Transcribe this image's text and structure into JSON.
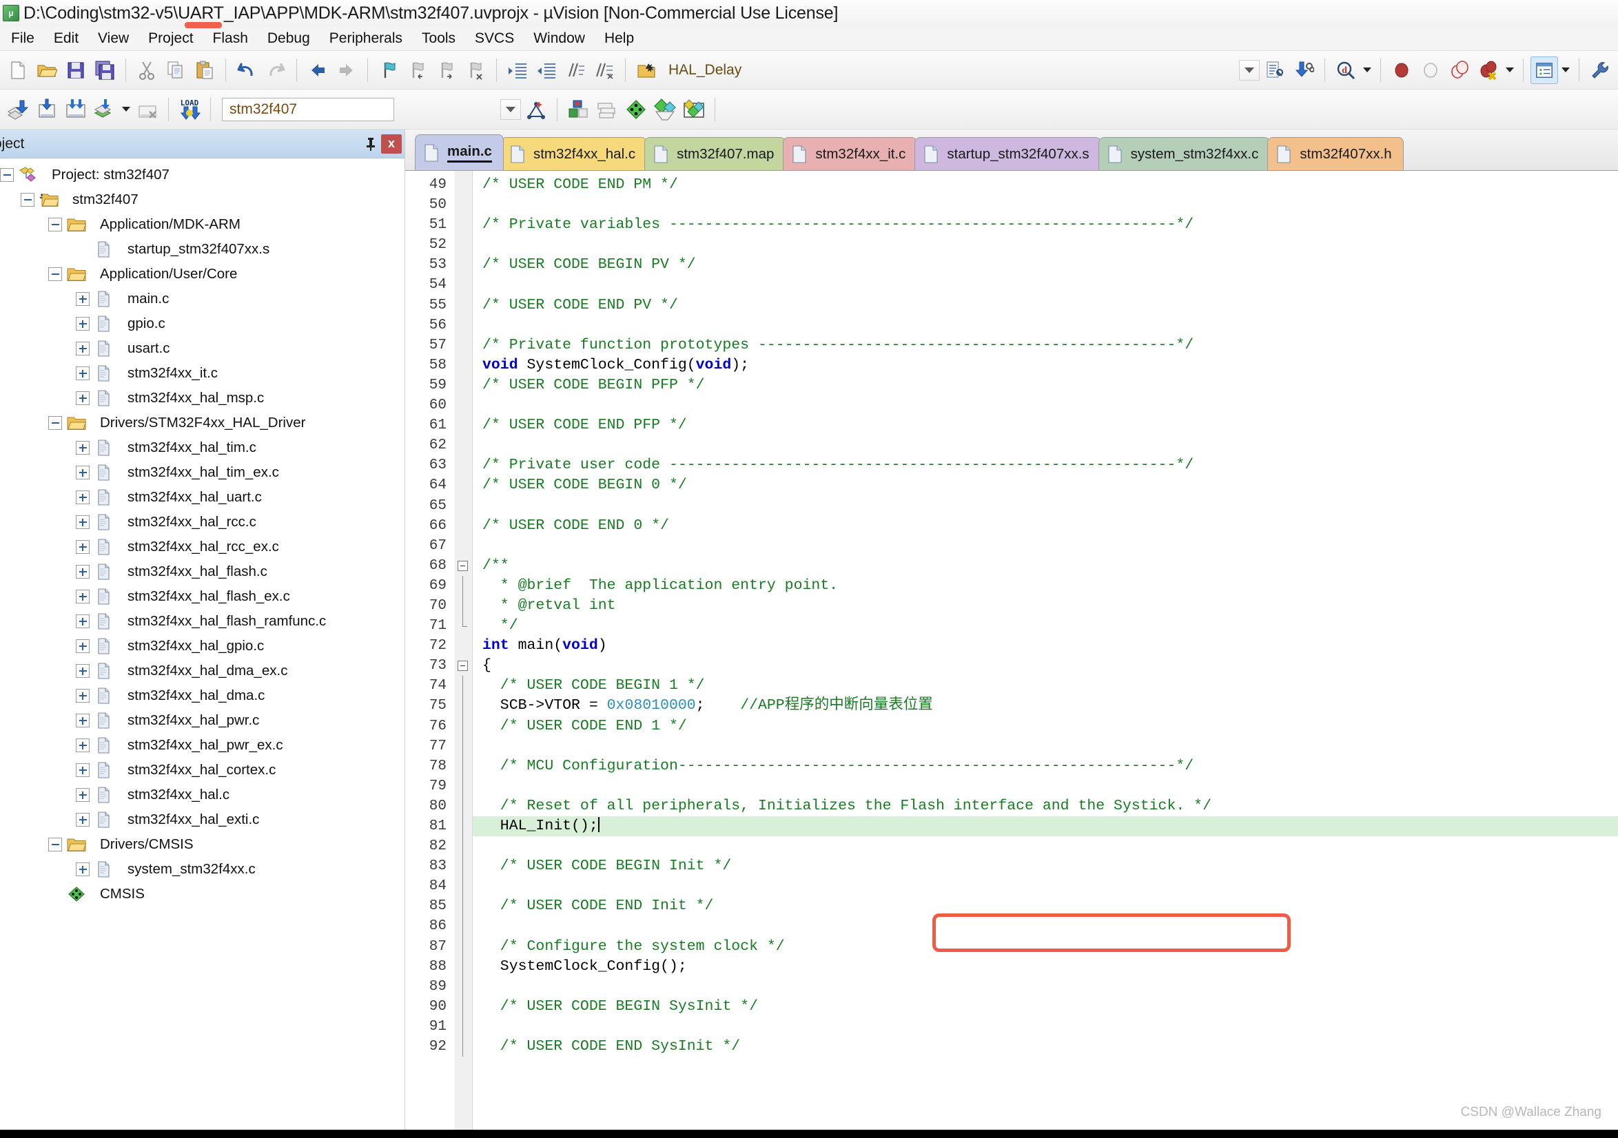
{
  "window": {
    "title": "D:\\Coding\\stm32-v5\\UART_IAP\\APP\\MDK-ARM\\stm32f407.uvprojx - µVision  [Non-Commercial Use License]",
    "app_icon": "uvision-icon",
    "annotation_color": "#ef5b46"
  },
  "menubar": {
    "items": [
      "File",
      "Edit",
      "View",
      "Project",
      "Flash",
      "Debug",
      "Peripherals",
      "Tools",
      "SVCS",
      "Window",
      "Help"
    ]
  },
  "toolbar_main": {
    "groups": [
      [
        "new-file-icon",
        "open-file-icon",
        "save-icon",
        "save-all-icon"
      ],
      [
        "cut-icon",
        "copy-icon",
        "paste-icon"
      ],
      [
        "undo-icon",
        "redo-icon"
      ],
      [
        "navigate-back-icon",
        "navigate-forward-icon"
      ],
      [
        "bookmark-toggle-icon",
        "bookmark-prev-icon",
        "bookmark-next-icon",
        "bookmark-clear-icon"
      ],
      [
        "indent-icon",
        "outdent-icon",
        "comment-icon",
        "uncomment-icon"
      ],
      [
        "find-in-files-icon"
      ]
    ],
    "function_box_value": "HAL_Delay",
    "right_groups": [
      [
        "dropdown-arrow-icon",
        "compile-file-icon",
        "download-icon"
      ],
      [
        "debug-session-icon"
      ],
      [
        "breakpoint-insert-icon",
        "breakpoint-disable-icon",
        "breakpoint-disable-all-icon",
        "breakpoint-kill-all-icon"
      ],
      [
        "project-window-icon"
      ],
      [
        "configure-icon"
      ]
    ]
  },
  "toolbar_build": {
    "buttons": [
      "translate-icon",
      "build-icon",
      "rebuild-icon",
      "batch-build-icon",
      "stop-build-icon",
      "download-load-icon"
    ],
    "target_value": "stm32f407",
    "right_buttons": [
      "options-target-icon",
      "manage-project-items-icon",
      "books-icon",
      "manage-runtime-env-icon",
      "pack-installer-icon",
      "select-software-packs-icon"
    ]
  },
  "project_panel": {
    "title": "roject",
    "pin_icon": "pin-icon",
    "close_icon": "close-icon",
    "tree": [
      {
        "label": "Project: stm32f407",
        "depth": 0,
        "icon": "project-icon",
        "expander": "minus"
      },
      {
        "label": "stm32f407",
        "depth": 1,
        "icon": "target-folder-icon",
        "expander": "minus"
      },
      {
        "label": "Application/MDK-ARM",
        "depth": 2,
        "icon": "folder-icon",
        "expander": "minus"
      },
      {
        "label": "startup_stm32f407xx.s",
        "depth": 3,
        "icon": "file-icon",
        "expander": "none"
      },
      {
        "label": "Application/User/Core",
        "depth": 2,
        "icon": "folder-icon",
        "expander": "minus"
      },
      {
        "label": "main.c",
        "depth": 3,
        "icon": "file-icon",
        "expander": "plus"
      },
      {
        "label": "gpio.c",
        "depth": 3,
        "icon": "file-icon",
        "expander": "plus"
      },
      {
        "label": "usart.c",
        "depth": 3,
        "icon": "file-icon",
        "expander": "plus"
      },
      {
        "label": "stm32f4xx_it.c",
        "depth": 3,
        "icon": "file-icon",
        "expander": "plus"
      },
      {
        "label": "stm32f4xx_hal_msp.c",
        "depth": 3,
        "icon": "file-icon",
        "expander": "plus"
      },
      {
        "label": "Drivers/STM32F4xx_HAL_Driver",
        "depth": 2,
        "icon": "folder-icon",
        "expander": "minus"
      },
      {
        "label": "stm32f4xx_hal_tim.c",
        "depth": 3,
        "icon": "file-icon",
        "expander": "plus"
      },
      {
        "label": "stm32f4xx_hal_tim_ex.c",
        "depth": 3,
        "icon": "file-icon",
        "expander": "plus"
      },
      {
        "label": "stm32f4xx_hal_uart.c",
        "depth": 3,
        "icon": "file-icon",
        "expander": "plus"
      },
      {
        "label": "stm32f4xx_hal_rcc.c",
        "depth": 3,
        "icon": "file-icon",
        "expander": "plus"
      },
      {
        "label": "stm32f4xx_hal_rcc_ex.c",
        "depth": 3,
        "icon": "file-icon",
        "expander": "plus"
      },
      {
        "label": "stm32f4xx_hal_flash.c",
        "depth": 3,
        "icon": "file-icon",
        "expander": "plus"
      },
      {
        "label": "stm32f4xx_hal_flash_ex.c",
        "depth": 3,
        "icon": "file-icon",
        "expander": "plus"
      },
      {
        "label": "stm32f4xx_hal_flash_ramfunc.c",
        "depth": 3,
        "icon": "file-icon",
        "expander": "plus"
      },
      {
        "label": "stm32f4xx_hal_gpio.c",
        "depth": 3,
        "icon": "file-icon",
        "expander": "plus"
      },
      {
        "label": "stm32f4xx_hal_dma_ex.c",
        "depth": 3,
        "icon": "file-icon",
        "expander": "plus"
      },
      {
        "label": "stm32f4xx_hal_dma.c",
        "depth": 3,
        "icon": "file-icon",
        "expander": "plus"
      },
      {
        "label": "stm32f4xx_hal_pwr.c",
        "depth": 3,
        "icon": "file-icon",
        "expander": "plus"
      },
      {
        "label": "stm32f4xx_hal_pwr_ex.c",
        "depth": 3,
        "icon": "file-icon",
        "expander": "plus"
      },
      {
        "label": "stm32f4xx_hal_cortex.c",
        "depth": 3,
        "icon": "file-icon",
        "expander": "plus"
      },
      {
        "label": "stm32f4xx_hal.c",
        "depth": 3,
        "icon": "file-icon",
        "expander": "plus"
      },
      {
        "label": "stm32f4xx_hal_exti.c",
        "depth": 3,
        "icon": "file-icon",
        "expander": "plus"
      },
      {
        "label": "Drivers/CMSIS",
        "depth": 2,
        "icon": "folder-icon",
        "expander": "minus"
      },
      {
        "label": "system_stm32f4xx.c",
        "depth": 3,
        "icon": "file-icon",
        "expander": "plus"
      },
      {
        "label": "CMSIS",
        "depth": 2,
        "icon": "cmsis-icon",
        "expander": "none"
      }
    ]
  },
  "editor": {
    "tabs": [
      {
        "label": "main.c",
        "color": "#c3cbe8",
        "selected": true
      },
      {
        "label": "stm32f4xx_hal.c",
        "color": "#f5d97a",
        "selected": false
      },
      {
        "label": "stm32f407.map",
        "color": "#c4d6a0",
        "selected": false
      },
      {
        "label": "stm32f4xx_it.c",
        "color": "#e8b0b0",
        "selected": false
      },
      {
        "label": "startup_stm32f407xx.s",
        "color": "#cfb8e0",
        "selected": false
      },
      {
        "label": "system_stm32f4xx.c",
        "color": "#b5ceb8",
        "selected": false
      },
      {
        "label": "stm32f407xx.h",
        "color": "#f3c08c",
        "selected": false
      }
    ],
    "first_line_number": 49,
    "highlight_line_number": 81,
    "cursor_line_number": 81,
    "lines": [
      {
        "n": 49,
        "tokens": [
          {
            "t": "/* USER CODE END PM */",
            "c": "cmt"
          }
        ]
      },
      {
        "n": 50,
        "tokens": []
      },
      {
        "n": 51,
        "tokens": [
          {
            "t": "/* Private variables ---------------------------------------------------------*/",
            "c": "cmt"
          }
        ]
      },
      {
        "n": 52,
        "tokens": []
      },
      {
        "n": 53,
        "tokens": [
          {
            "t": "/* USER CODE BEGIN PV */",
            "c": "cmt"
          }
        ]
      },
      {
        "n": 54,
        "tokens": []
      },
      {
        "n": 55,
        "tokens": [
          {
            "t": "/* USER CODE END PV */",
            "c": "cmt"
          }
        ]
      },
      {
        "n": 56,
        "tokens": []
      },
      {
        "n": 57,
        "tokens": [
          {
            "t": "/* Private function prototypes -----------------------------------------------*/",
            "c": "cmt"
          }
        ]
      },
      {
        "n": 58,
        "tokens": [
          {
            "t": "void",
            "c": "kw"
          },
          {
            "t": " SystemClock_Config(",
            "c": "pln"
          },
          {
            "t": "void",
            "c": "kw"
          },
          {
            "t": ");",
            "c": "pln"
          }
        ]
      },
      {
        "n": 59,
        "tokens": [
          {
            "t": "/* USER CODE BEGIN PFP */",
            "c": "cmt"
          }
        ]
      },
      {
        "n": 60,
        "tokens": []
      },
      {
        "n": 61,
        "tokens": [
          {
            "t": "/* USER CODE END PFP */",
            "c": "cmt"
          }
        ]
      },
      {
        "n": 62,
        "tokens": []
      },
      {
        "n": 63,
        "tokens": [
          {
            "t": "/* Private user code ---------------------------------------------------------*/",
            "c": "cmt"
          }
        ]
      },
      {
        "n": 64,
        "tokens": [
          {
            "t": "/* USER CODE BEGIN 0 */",
            "c": "cmt"
          }
        ]
      },
      {
        "n": 65,
        "tokens": []
      },
      {
        "n": 66,
        "tokens": [
          {
            "t": "/* USER CODE END 0 */",
            "c": "cmt"
          }
        ]
      },
      {
        "n": 67,
        "tokens": []
      },
      {
        "n": 68,
        "tokens": [
          {
            "t": "/**",
            "c": "cmt"
          }
        ],
        "fold": "open"
      },
      {
        "n": 69,
        "tokens": [
          {
            "t": "  * @brief  The application entry point.",
            "c": "cmt"
          }
        ],
        "fold": "bar"
      },
      {
        "n": 70,
        "tokens": [
          {
            "t": "  * @retval int",
            "c": "cmt"
          }
        ],
        "fold": "bar"
      },
      {
        "n": 71,
        "tokens": [
          {
            "t": "  */",
            "c": "cmt"
          }
        ],
        "fold": "end"
      },
      {
        "n": 72,
        "tokens": [
          {
            "t": "int",
            "c": "kw"
          },
          {
            "t": " main(",
            "c": "pln"
          },
          {
            "t": "void",
            "c": "kw"
          },
          {
            "t": ")",
            "c": "pln"
          }
        ]
      },
      {
        "n": 73,
        "tokens": [
          {
            "t": "{",
            "c": "pln"
          }
        ],
        "fold": "open"
      },
      {
        "n": 74,
        "tokens": [
          {
            "t": "  /* USER CODE BEGIN 1 */",
            "c": "cmt"
          }
        ],
        "fold": "bar"
      },
      {
        "n": 75,
        "tokens": [
          {
            "t": "  SCB->VTOR = ",
            "c": "pln"
          },
          {
            "t": "0x08010000",
            "c": "num"
          },
          {
            "t": ";    ",
            "c": "pln"
          },
          {
            "t": "//APP程序的中断向量表位置",
            "c": "cmt"
          }
        ],
        "fold": "bar"
      },
      {
        "n": 76,
        "tokens": [
          {
            "t": "  /* USER CODE END 1 */",
            "c": "cmt"
          }
        ],
        "fold": "bar"
      },
      {
        "n": 77,
        "tokens": [],
        "fold": "bar"
      },
      {
        "n": 78,
        "tokens": [
          {
            "t": "  /* MCU Configuration--------------------------------------------------------*/",
            "c": "cmt"
          }
        ],
        "fold": "bar"
      },
      {
        "n": 79,
        "tokens": [],
        "fold": "bar"
      },
      {
        "n": 80,
        "tokens": [
          {
            "t": "  /* Reset of all peripherals, Initializes the Flash interface and the Systick. */",
            "c": "cmt"
          }
        ],
        "fold": "bar"
      },
      {
        "n": 81,
        "tokens": [
          {
            "t": "  HAL_Init();",
            "c": "pln"
          }
        ],
        "fold": "bar",
        "highlight": true,
        "cursor": true
      },
      {
        "n": 82,
        "tokens": [],
        "fold": "bar"
      },
      {
        "n": 83,
        "tokens": [
          {
            "t": "  /* USER CODE BEGIN Init */",
            "c": "cmt"
          }
        ],
        "fold": "bar"
      },
      {
        "n": 84,
        "tokens": [],
        "fold": "bar"
      },
      {
        "n": 85,
        "tokens": [
          {
            "t": "  /* USER CODE END Init */",
            "c": "cmt"
          }
        ],
        "fold": "bar"
      },
      {
        "n": 86,
        "tokens": [],
        "fold": "bar"
      },
      {
        "n": 87,
        "tokens": [
          {
            "t": "  /* Configure the system clock */",
            "c": "cmt"
          }
        ],
        "fold": "bar"
      },
      {
        "n": 88,
        "tokens": [
          {
            "t": "  SystemClock_Config();",
            "c": "pln"
          }
        ],
        "fold": "bar"
      },
      {
        "n": 89,
        "tokens": [],
        "fold": "bar"
      },
      {
        "n": 90,
        "tokens": [
          {
            "t": "  /* USER CODE BEGIN SysInit */",
            "c": "cmt"
          }
        ],
        "fold": "bar"
      },
      {
        "n": 91,
        "tokens": [],
        "fold": "bar"
      },
      {
        "n": 92,
        "tokens": [
          {
            "t": "  /* USER CODE END SysInit */",
            "c": "cmt"
          }
        ],
        "fold": "bar"
      }
    ]
  },
  "watermark": "CSDN @Wallace Zhang"
}
